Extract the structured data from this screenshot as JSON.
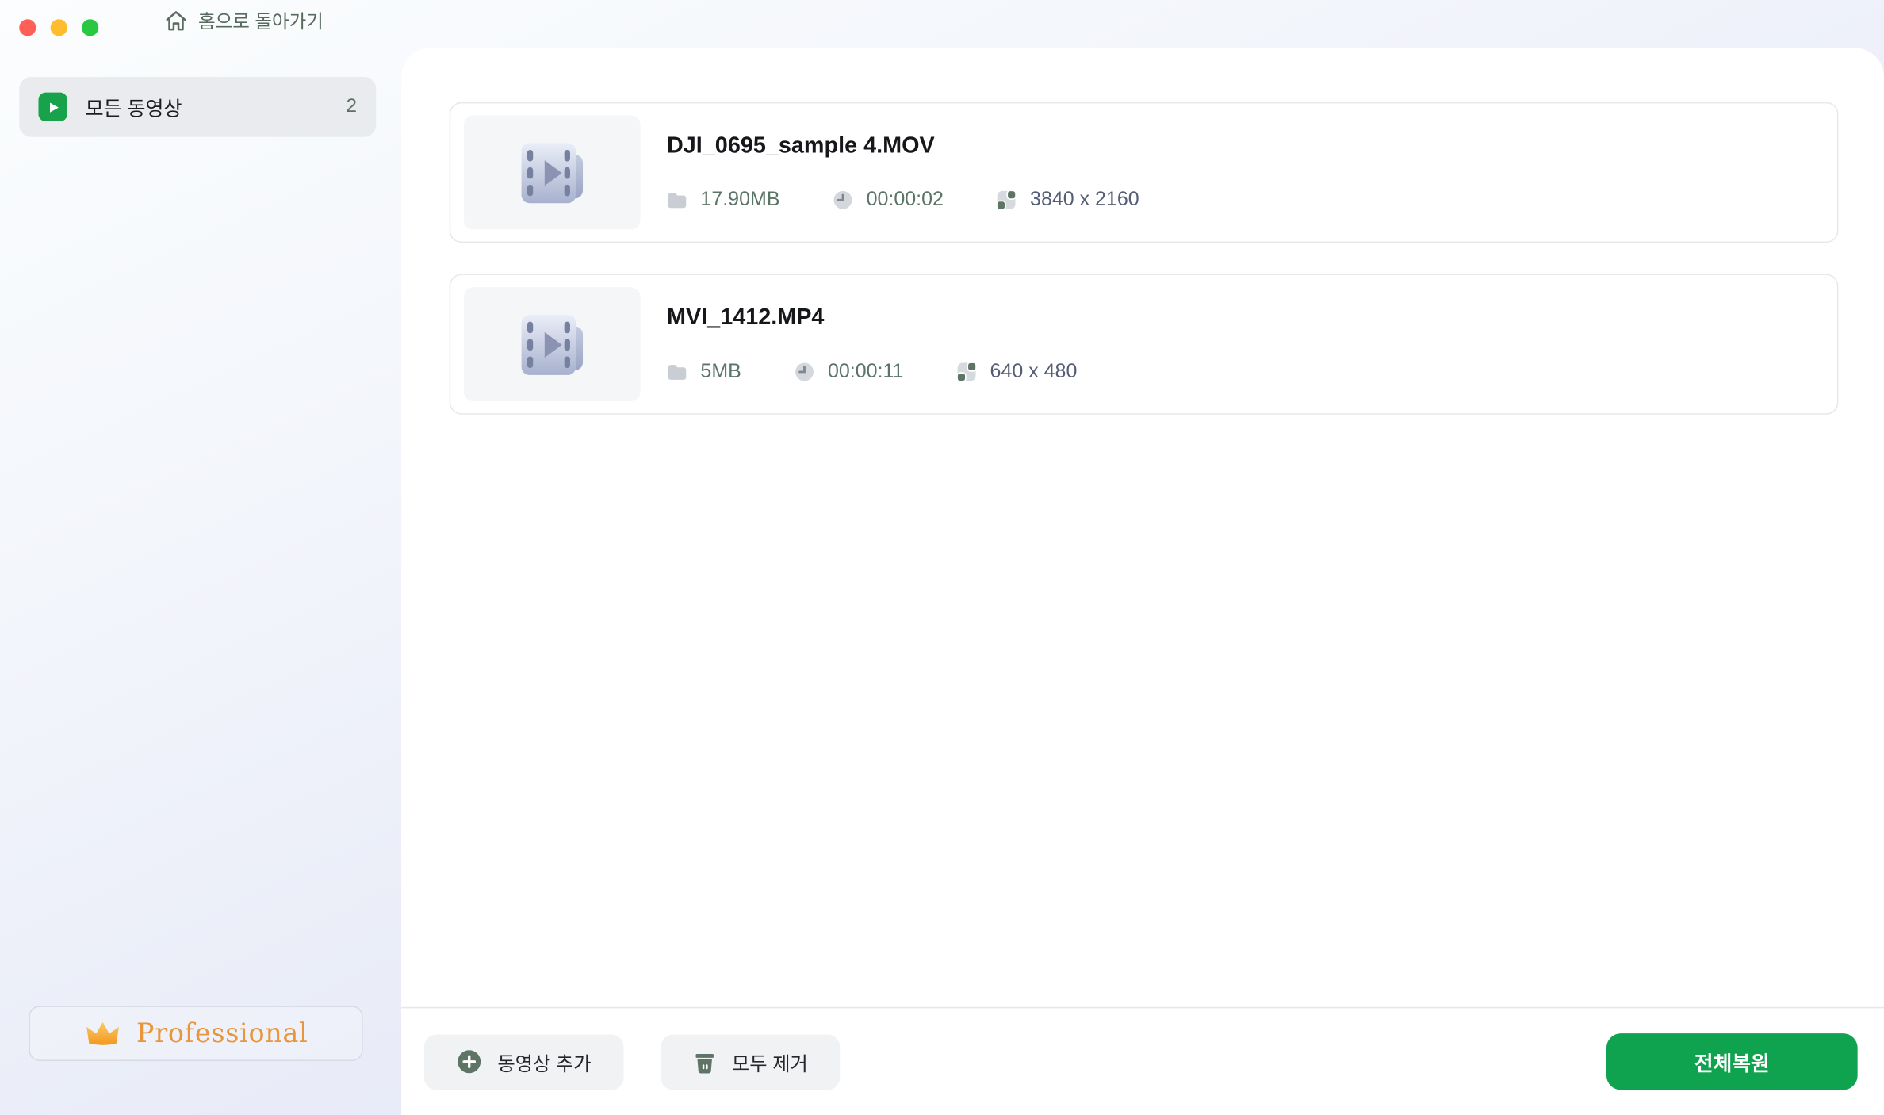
{
  "window": {
    "controls": [
      {
        "name": "close",
        "color": "#FF5F57"
      },
      {
        "name": "minimize",
        "color": "#FEBC2E"
      },
      {
        "name": "zoom",
        "color": "#28C840"
      }
    ],
    "home_button_label": "홈으로 돌아가기"
  },
  "sidebar": {
    "items": [
      {
        "label": "모든 동영상",
        "count": "2",
        "icon": "video-play-icon"
      }
    ],
    "license_badge_label": "Professional"
  },
  "videos": [
    {
      "name": "DJI_0695_sample 4.MOV",
      "size": "17.90MB",
      "duration": "00:00:02",
      "resolution": "3840 x 2160"
    },
    {
      "name": "MVI_1412.MP4",
      "size": "5MB",
      "duration": "00:00:11",
      "resolution": "640 x 480"
    }
  ],
  "footer": {
    "add_video_label": "동영상 추가",
    "remove_all_label": "모두 제거",
    "restore_all_label": "전체복원"
  },
  "icons": {
    "home": "house-icon",
    "sidebar_item": "video-play-icon",
    "thumbnail": "film-strip-icon",
    "size": "folder-icon",
    "duration": "clock-icon",
    "resolution": "dimensions-icon",
    "add_video": "plus-circle-icon",
    "remove_all": "trash-icon",
    "license": "crown-icon"
  },
  "colors": {
    "accent_green": "#0FA24F",
    "sidebar_icon_green": "#17A24B",
    "meta_text_green": "#5B7468",
    "resolution_text": "#565E76",
    "professional_orange": "#E8963C",
    "home_text": "#57695C"
  }
}
